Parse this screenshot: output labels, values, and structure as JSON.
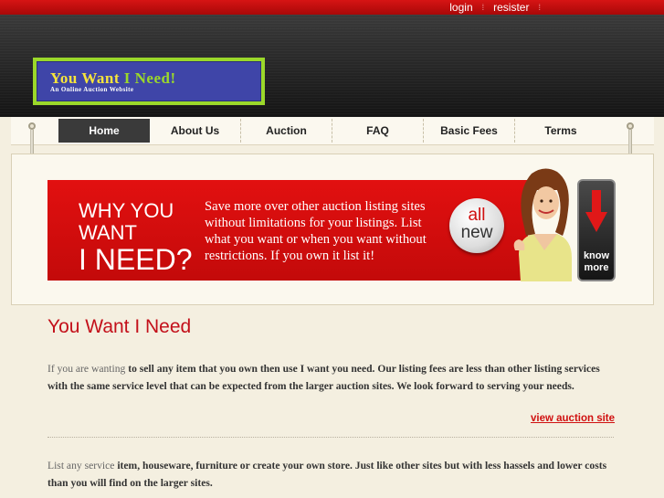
{
  "topbar": {
    "login_label": "login",
    "register_label": "resister"
  },
  "logo": {
    "title_part1": "You",
    "title_part2": "Want",
    "title_part3": "I Need!",
    "subtitle": "An Online Auction Website"
  },
  "nav": {
    "items": [
      {
        "label": "Home",
        "active": true
      },
      {
        "label": "About Us",
        "active": false
      },
      {
        "label": "Auction",
        "active": false
      },
      {
        "label": "FAQ",
        "active": false
      },
      {
        "label": "Basic Fees",
        "active": false
      },
      {
        "label": "Terms",
        "active": false
      }
    ]
  },
  "banner": {
    "headline_line1": "WHY YOU",
    "headline_line2": "WANT",
    "headline_line3": "I NEED?",
    "text": "Save more over other auction listing sites without limitations for your listings. List what you want or when you want without restrictions. If you own it list it!",
    "badge_line1": "all",
    "badge_line2": "new",
    "know_more_line1": "know",
    "know_more_line2": "more"
  },
  "content": {
    "title": "You Want I Need",
    "p1_start": "If you are wanting ",
    "p1_bold": "to sell any item that you own then use I want you need. Our listing fees are less than other listing services with the same service level that can be expected from the larger auction sites. We look forward to serving your needs.",
    "view_link": "view auction site",
    "p2_start": "List any service ",
    "p2_bold": "item, houseware, furniture or create your own store. Just like other sites but with less hassels and lower costs than you will find on the larger sites."
  },
  "colors": {
    "brand_red": "#d01010",
    "logo_green": "#9bd82a",
    "logo_blue": "#3f45a8",
    "logo_yellow": "#f7e43b"
  }
}
